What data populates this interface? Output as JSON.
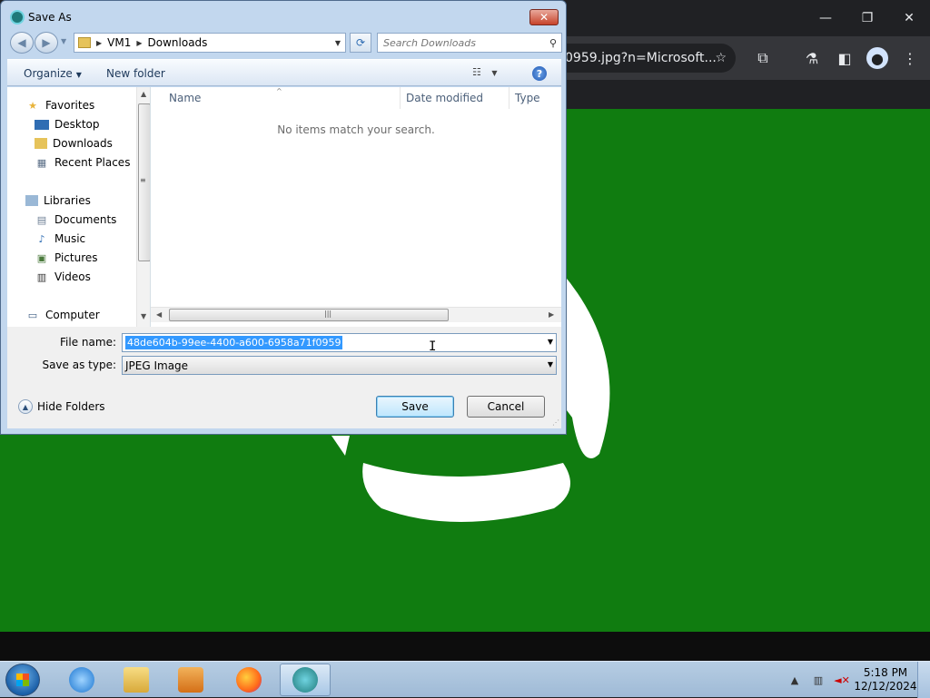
{
  "browser": {
    "address_text": "0959.jpg?n=Microsoft...",
    "background_color": "#107c10",
    "icons": [
      "minimize-icon",
      "restore-icon",
      "close-icon",
      "star-icon",
      "extensions-icon",
      "labs-icon",
      "side-panel-icon",
      "profile-icon",
      "menu-icon"
    ]
  },
  "dialog": {
    "title": "Save As",
    "nav": {
      "breadcrumb": [
        "VM1",
        "Downloads"
      ],
      "search_placeholder": "Search Downloads"
    },
    "commands": {
      "organize": "Organize",
      "new_folder": "New folder"
    },
    "nav_pane": {
      "favorites": "Favorites",
      "desktop": "Desktop",
      "downloads": "Downloads",
      "recent_places": "Recent Places",
      "libraries": "Libraries",
      "documents": "Documents",
      "music": "Music",
      "pictures": "Pictures",
      "videos": "Videos",
      "computer": "Computer"
    },
    "columns": {
      "name": "Name",
      "date_modified": "Date modified",
      "type": "Type"
    },
    "empty_message": "No items match your search.",
    "file_name_label": "File name:",
    "file_name_value": "48de604b-99ee-4400-a600-6958a71f0959",
    "save_as_type_label": "Save as type:",
    "save_as_type_value": "JPEG Image",
    "hide_folders": "Hide Folders",
    "save_button": "Save",
    "cancel_button": "Cancel"
  },
  "taskbar": {
    "time": "5:18 PM",
    "date": "12/12/2024"
  }
}
